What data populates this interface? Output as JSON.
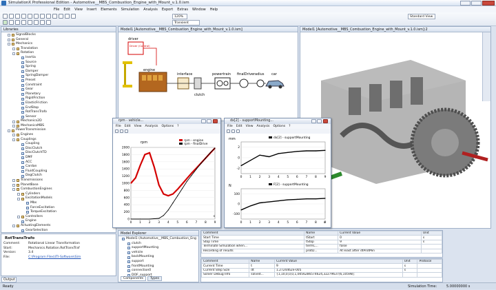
{
  "app": {
    "title": "SimulationX Professional Edition - Automotive__MBS_Combustion_Engine_with_Mount_v.1.0.ism"
  },
  "menu": [
    "File",
    "Edit",
    "View",
    "Insert",
    "Elements",
    "Simulation",
    "Analysis",
    "Export",
    "Extras",
    "Window",
    "Help"
  ],
  "toolbar": {
    "zoom": "120%",
    "solver": "Transient",
    "view": "Standard View"
  },
  "library": {
    "title": "Libraries",
    "items": [
      {
        "label": "SignalBlocks",
        "indent": 1,
        "folder": true
      },
      {
        "label": "General",
        "indent": 1,
        "folder": true
      },
      {
        "label": "Mechanics",
        "indent": 1,
        "folder": true
      },
      {
        "label": "Translation",
        "indent": 2,
        "folder": true
      },
      {
        "label": "Rotation",
        "indent": 2,
        "folder": true
      },
      {
        "label": "Inertia",
        "indent": 3,
        "folder": false
      },
      {
        "label": "Source",
        "indent": 3,
        "folder": false
      },
      {
        "label": "Spring",
        "indent": 3,
        "folder": false
      },
      {
        "label": "Damper",
        "indent": 3,
        "folder": false
      },
      {
        "label": "SpringDamper",
        "indent": 3,
        "folder": false
      },
      {
        "label": "Preset",
        "indent": 3,
        "folder": false
      },
      {
        "label": "Constraint",
        "indent": 3,
        "folder": false
      },
      {
        "label": "Gear",
        "indent": 3,
        "folder": false
      },
      {
        "label": "Planetary",
        "indent": 3,
        "folder": false
      },
      {
        "label": "RigidFriction",
        "indent": 3,
        "folder": false
      },
      {
        "label": "ElasticFriction",
        "indent": 3,
        "folder": false
      },
      {
        "label": "EndStop",
        "indent": 3,
        "folder": false
      },
      {
        "label": "RotTransTrafo",
        "indent": 3,
        "folder": false
      },
      {
        "label": "Sensor",
        "indent": 3,
        "folder": false
      },
      {
        "label": "Mechanics2D",
        "indent": 2,
        "folder": true
      },
      {
        "label": "MechanicsMBS",
        "indent": 2,
        "folder": true
      },
      {
        "label": "PowerTransmission",
        "indent": 1,
        "folder": true
      },
      {
        "label": "Engines",
        "indent": 2,
        "folder": true
      },
      {
        "label": "Couplings",
        "indent": 2,
        "folder": true
      },
      {
        "label": "Coupling",
        "indent": 3,
        "folder": false
      },
      {
        "label": "DiscClutch",
        "indent": 3,
        "folder": false
      },
      {
        "label": "DiscClutchTD",
        "indent": 3,
        "folder": false
      },
      {
        "label": "DMF",
        "indent": 3,
        "folder": false
      },
      {
        "label": "ACC",
        "indent": 3,
        "folder": false
      },
      {
        "label": "Cardan",
        "indent": 3,
        "folder": false
      },
      {
        "label": "FluidCoupling",
        "indent": 3,
        "folder": false
      },
      {
        "label": "DogClutch",
        "indent": 3,
        "folder": false
      },
      {
        "label": "Transmissions",
        "indent": 2,
        "folder": true
      },
      {
        "label": "PlanetBase",
        "indent": 2,
        "folder": true
      },
      {
        "label": "CombustionEngines",
        "indent": 2,
        "folder": true
      },
      {
        "label": "Cylinders",
        "indent": 3,
        "folder": true
      },
      {
        "label": "ExcitationModels",
        "indent": 3,
        "folder": true
      },
      {
        "label": "Mbs",
        "indent": 4,
        "folder": false
      },
      {
        "label": "ForceExcitation",
        "indent": 4,
        "folder": false
      },
      {
        "label": "TorqueExcitation",
        "indent": 4,
        "folder": false
      },
      {
        "label": "Controllers",
        "indent": 3,
        "folder": true
      },
      {
        "label": "Engine",
        "indent": 3,
        "folder": false
      },
      {
        "label": "ActuatingElements",
        "indent": 2,
        "folder": true
      },
      {
        "label": "GearSelection",
        "indent": 3,
        "folder": false
      }
    ]
  },
  "properties": {
    "name": "RotTransTrafo",
    "rows": [
      {
        "k": "Comment:",
        "v": "Rotational Linear Transformation"
      },
      {
        "k": "Start:",
        "v": "Mechanics.Rotation.RotTransTraf"
      },
      {
        "k": "Version:",
        "v": "3.4"
      },
      {
        "k": "File:",
        "v": "C:\\Program Files\\ITI-Software\\Sim"
      }
    ]
  },
  "output_tab": "Output",
  "diagram": {
    "tab": "Model1 [Automotive__MBS_Combustion_Engine_with_Mount_v.1.0.ism]",
    "labels": {
      "driver": "driver",
      "driver_box": "Driver (Control)",
      "engine": "engine",
      "interface": "interface",
      "clutch": "clutch",
      "powertrain": "powertrain",
      "finaldrive": "finalDrive",
      "radius": "radius",
      "car": "car"
    }
  },
  "view3d": {
    "tab": "Model1 [Automotive__MBS_Combustion_Engine_with_Mount_v.1.0.ism]:2"
  },
  "plot1": {
    "title": "rpm - vehicle...",
    "menu": [
      "File",
      "Edit",
      "View",
      "Analysis",
      "Options",
      "?"
    ],
    "legend": [
      "rpm - engine",
      "rpm - finalDrive"
    ],
    "ylabel": "rpm",
    "xunit": "s",
    "yticks": [
      "2000",
      "1800",
      "1600",
      "1400",
      "1200",
      "1000",
      "800",
      "600",
      "400",
      "200",
      "0"
    ],
    "xticks": [
      "0",
      "1",
      "2",
      "3",
      "4",
      "5",
      "6",
      "7",
      "8",
      "9"
    ]
  },
  "plot2": {
    "title": "dx[2] - supportMounting...",
    "menu": [
      "File",
      "Edit",
      "View",
      "Analysis",
      "Options",
      "?"
    ],
    "top_unit": "mm",
    "top_legend": "dx[2] - supportMounting",
    "top_yticks": [
      "2",
      "0",
      "-2"
    ],
    "bottom_unit": "N",
    "bottom_legend": "F[2] - supportMounting",
    "bottom_yticks": [
      "100",
      "0",
      "-100"
    ],
    "xticks": [
      "0",
      "1",
      "2",
      "3",
      "4",
      "5",
      "6",
      "7",
      "8",
      "9"
    ],
    "xunit": "s"
  },
  "model_explorer": {
    "title": "Model Explorer",
    "items": [
      "Model1 (Automotive__MBS_Combustion_Eng",
      "clutch",
      "supportMounting",
      "vehicle",
      "backMounting",
      "support",
      "frontMounting",
      "connection0",
      "DOF_support"
    ],
    "tabs": [
      "Components",
      "Types"
    ]
  },
  "sim_params": {
    "headers": [
      "Comment",
      "Name",
      "Current Value",
      "Unit"
    ],
    "rows": [
      [
        "Start Time",
        "tStart",
        "0",
        "s"
      ],
      [
        "Stop Time",
        "tStop",
        "9",
        "s"
      ],
      [
        "Terminate Simulation when...",
        "termC...",
        "false",
        ""
      ],
      [
        "Recording of results",
        "protD...",
        "At least after dtProtMin",
        ""
      ]
    ]
  },
  "results": {
    "headers": [
      "Comment",
      "Name",
      "Current Value",
      "Unit",
      "Protocol"
    ],
    "rows": [
      [
        "Current Time",
        "t",
        "9",
        "s",
        ""
      ],
      [
        "Current Step Size",
        "dt",
        "1.2724462e-005",
        "s",
        ""
      ],
      [
        "Solver Debug Info",
        "solved...",
        "{1,10,0,0,0,1,0056286574624,32279637(6,10598);",
        "",
        ""
      ]
    ]
  },
  "status": {
    "left": "Ready",
    "sim_label": "Simulation Time:",
    "sim_value": "5.00000000 s"
  },
  "chart_data": [
    {
      "type": "line",
      "title": "",
      "ylabel": "rpm",
      "xlabel": "s",
      "xlim": [
        0,
        9
      ],
      "ylim": [
        0,
        2000
      ],
      "series": [
        {
          "name": "rpm - engine",
          "x": [
            0,
            0.5,
            1,
            1.5,
            2,
            2.5,
            3,
            3.5,
            4,
            4.5,
            5,
            5.5,
            6,
            6.5,
            7,
            7.5,
            8,
            8.5,
            9
          ],
          "y": [
            1000,
            1150,
            1500,
            1800,
            1850,
            1450,
            950,
            700,
            650,
            700,
            830,
            980,
            1130,
            1280,
            1420,
            1560,
            1700,
            1840,
            1980
          ]
        },
        {
          "name": "rpm - finalDrive",
          "x": [
            0,
            1,
            2,
            3,
            3.5,
            4,
            4.5,
            5,
            5.5,
            6,
            6.5,
            7,
            7.5,
            8,
            8.5,
            9
          ],
          "y": [
            0,
            0,
            0,
            20,
            100,
            250,
            450,
            650,
            850,
            1050,
            1220,
            1390,
            1550,
            1700,
            1850,
            1980
          ]
        }
      ]
    },
    {
      "type": "line",
      "title": "",
      "ylabel": "mm",
      "xlabel": "s",
      "xlim": [
        0,
        9
      ],
      "ylim": [
        -3,
        3
      ],
      "series": [
        {
          "name": "dx[2] - supportMounting",
          "x": [
            0,
            1,
            2,
            3,
            4,
            5,
            6,
            7,
            8,
            9
          ],
          "y": [
            -1.5,
            -0.5,
            0.5,
            0.2,
            0.8,
            1,
            1.2,
            1.3,
            1.3,
            1.4
          ]
        }
      ]
    },
    {
      "type": "line",
      "title": "",
      "ylabel": "N",
      "xlabel": "s",
      "xlim": [
        0,
        9
      ],
      "ylim": [
        -150,
        150
      ],
      "series": [
        {
          "name": "F[2] - supportMounting",
          "x": [
            0,
            1,
            2,
            3,
            4,
            5,
            6,
            7,
            8,
            9
          ],
          "y": [
            -60,
            -20,
            10,
            20,
            30,
            40,
            45,
            50,
            50,
            55
          ]
        }
      ]
    }
  ],
  "colors": {
    "engine_line": "#d40000",
    "drive_line": "#000000",
    "accent": "#3b73c4",
    "plot_bg": "#ffffff"
  }
}
